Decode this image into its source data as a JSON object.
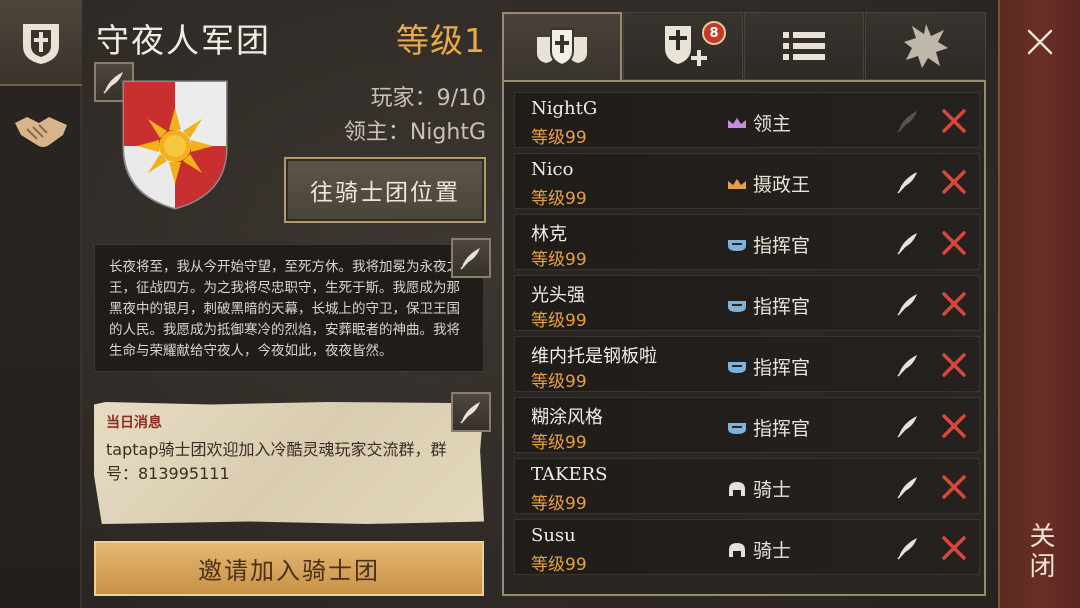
{
  "side_tabs": [
    {
      "icon": "guild-helmet-icon"
    },
    {
      "icon": "handshake-icon"
    }
  ],
  "guild": {
    "name": "守夜人军团",
    "level": "等级1",
    "players": "玩家：9/10",
    "leader": "领主：NightG",
    "goto_button": "往骑士团位置",
    "motto": "长夜将至，我从今开始守望，至死方休。我将加冕为永夜之王，征战四方。为之我将尽忠职守，生死于斯。我愿成为那黑夜中的银月，刺破黑暗的天幕，长城上的守卫，保卫王国的人民。我愿成为抵御寒冷的烈焰，安葬眠者的神曲。我将生命与荣耀献给守夜人，今夜如此，夜夜皆然。",
    "notice_title": "当日消息",
    "notice_text": "taptap骑士团欢迎加入冷酷灵魂玩家交流群，群号：813995111",
    "invite_button": "邀请加入骑士团"
  },
  "tabs": [
    {
      "icon": "members-icon",
      "active": true
    },
    {
      "icon": "add-member-icon",
      "badge": "8"
    },
    {
      "icon": "list-icon"
    },
    {
      "icon": "starburst-icon"
    }
  ],
  "members": [
    {
      "name": "NightG",
      "level": "等级99",
      "rank": "领主",
      "rank_color": "#c98be0",
      "rank_icon": "crown-icon"
    },
    {
      "name": "Nico",
      "level": "等级99",
      "rank": "摄政王",
      "rank_color": "#e0a050",
      "rank_icon": "crown-icon"
    },
    {
      "name": "林克",
      "level": "等级99",
      "rank": "指挥官",
      "rank_color": "#7fb2d8",
      "rank_icon": "helmet-icon"
    },
    {
      "name": "光头强",
      "level": "等级99",
      "rank": "指挥官",
      "rank_color": "#7fb2d8",
      "rank_icon": "helmet-icon"
    },
    {
      "name": "维内托是钢板啦",
      "level": "等级99",
      "rank": "指挥官",
      "rank_color": "#7fb2d8",
      "rank_icon": "helmet-icon"
    },
    {
      "name": "糊涂风格",
      "level": "等级99",
      "rank": "指挥官",
      "rank_color": "#7fb2d8",
      "rank_icon": "helmet-icon"
    },
    {
      "name": "TAKERS",
      "level": "等级99",
      "rank": "骑士",
      "rank_color": "#e6e0d6",
      "rank_icon": "knight-helm-icon"
    },
    {
      "name": "Susu",
      "level": "等级99",
      "rank": "骑士",
      "rank_color": "#e6e0d6",
      "rank_icon": "knight-helm-icon"
    }
  ],
  "close_label": "关闭"
}
